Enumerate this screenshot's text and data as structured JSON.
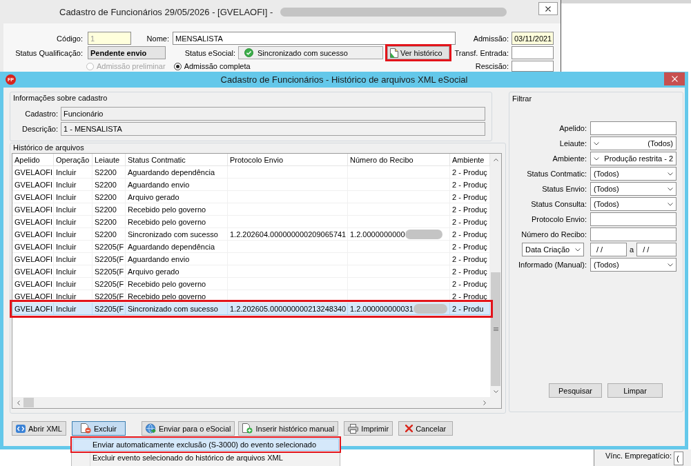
{
  "background_window": {
    "title": "Cadastro de Funcionários 29/05/2026 - [GVELAOFI] -",
    "title_redacted": true,
    "codigo": {
      "label": "Código:",
      "value": "1",
      "disabled": true
    },
    "nome": {
      "label": "Nome:",
      "value": "MENSALISTA"
    },
    "admissao": {
      "label": "Admissão:",
      "value": "03/11/2021"
    },
    "status_qualificacao": {
      "label": "Status Qualificação:",
      "value": "Pendente envio"
    },
    "status_esocial": {
      "label": "Status eSocial:",
      "value": "Sincronizado com sucesso"
    },
    "ver_historico": {
      "label": "Ver histórico",
      "highlighted": true
    },
    "transf_entrada": {
      "label": "Transf. Entrada:"
    },
    "admission_options": [
      {
        "label": "Admissão preliminar",
        "selected": false,
        "disabled": true
      },
      {
        "label": "Admissão completa",
        "selected": true,
        "disabled": false
      }
    ],
    "rescisao": {
      "label": "Rescisão:"
    },
    "vinc_empregaticio": {
      "label": "Vínc. Empregatício:",
      "value": "("
    }
  },
  "dialog": {
    "icon_label": "FP",
    "title": "Cadastro de Funcionários - Histórico de arquivos XML eSocial",
    "info": {
      "title": "Informações sobre cadastro",
      "fields": [
        {
          "label": "Cadastro:",
          "value": "Funcionário"
        },
        {
          "label": "Descrição:",
          "value": "1 - MENSALISTA"
        }
      ]
    },
    "history": {
      "title": "Histórico de arquivos",
      "columns": [
        "Apelido",
        "Operação",
        "Leiaute",
        "Status Contmatic",
        "Protocolo Envio",
        "Número do Recibo",
        "Ambiente"
      ],
      "rows": [
        {
          "apelido": "GVELAOFI",
          "operacao": "Incluir",
          "leiaute": "S2200",
          "status": "Aguardando dependência",
          "ambiente": "2 - Produç",
          "selected": false,
          "highlighted": false
        },
        {
          "apelido": "GVELAOFI",
          "operacao": "Incluir",
          "leiaute": "S2200",
          "status": "Aguardando envio",
          "ambiente": "2 - Produç",
          "selected": false,
          "highlighted": false
        },
        {
          "apelido": "GVELAOFI",
          "operacao": "Incluir",
          "leiaute": "S2200",
          "status": "Arquivo gerado",
          "ambiente": "2 - Produç",
          "selected": false,
          "highlighted": false
        },
        {
          "apelido": "GVELAOFI",
          "operacao": "Incluir",
          "leiaute": "S2200",
          "status": "Recebido pelo governo",
          "ambiente": "2 - Produç",
          "selected": false,
          "highlighted": false
        },
        {
          "apelido": "GVELAOFI",
          "operacao": "Incluir",
          "leiaute": "S2200",
          "status": "Recebido pelo governo",
          "ambiente": "2 - Produç",
          "selected": false,
          "highlighted": false
        },
        {
          "apelido": "GVELAOFI",
          "operacao": "Incluir",
          "leiaute": "S2200",
          "status": "Sincronizado com sucesso",
          "protocolo": "1.2.202604.000000000209065741",
          "recibo": {
            "text": "1.2.0000000000",
            "redacted": true
          },
          "ambiente": "2 - Produç",
          "selected": false,
          "highlighted": false
        },
        {
          "apelido": "GVELAOFI",
          "operacao": "Incluir",
          "leiaute": "S2205(F",
          "status": "Aguardando dependência",
          "ambiente": "2 - Produç",
          "selected": false,
          "highlighted": false
        },
        {
          "apelido": "GVELAOFI",
          "operacao": "Incluir",
          "leiaute": "S2205(F",
          "status": "Aguardando envio",
          "ambiente": "2 - Produç",
          "selected": false,
          "highlighted": false
        },
        {
          "apelido": "GVELAOFI",
          "operacao": "Incluir",
          "leiaute": "S2205(F",
          "status": "Arquivo gerado",
          "ambiente": "2 - Produç",
          "selected": false,
          "highlighted": false
        },
        {
          "apelido": "GVELAOFI",
          "operacao": "Incluir",
          "leiaute": "S2205(F",
          "status": "Recebido pelo governo",
          "ambiente": "2 - Produç",
          "selected": false,
          "highlighted": false
        },
        {
          "apelido": "GVELAOFI",
          "operacao": "Incluir",
          "leiaute": "S2205(F",
          "status": "Recebido pelo governo",
          "ambiente": "2 - Produç",
          "selected": false,
          "highlighted": false
        },
        {
          "apelido": "GVELAOFI",
          "operacao": "Incluir",
          "leiaute": "S2205(F",
          "status": "Sincronizado com sucesso",
          "protocolo": "1.2.202605.000000000213248340",
          "recibo": {
            "text": "1.2.000000000031",
            "redacted": true
          },
          "ambiente": "2 - Produ",
          "selected": true,
          "highlighted": true
        }
      ]
    },
    "filter": {
      "title": "Filtrar",
      "fields": [
        {
          "kind": "text",
          "label": "Apelido:"
        },
        {
          "kind": "combo-left",
          "label": "Leiaute:",
          "value": "(Todos)"
        },
        {
          "kind": "combo-left",
          "label": "Ambiente:",
          "value": "Produção restrita - 2"
        },
        {
          "kind": "combo",
          "label": "Status Contmatic:",
          "value": "(Todos)"
        },
        {
          "kind": "combo",
          "label": "Status Envio:",
          "value": "(Todos)"
        },
        {
          "kind": "combo",
          "label": "Status Consulta:",
          "value": "(Todos)"
        },
        {
          "kind": "text",
          "label": "Protocolo Envio:"
        },
        {
          "kind": "text",
          "label": "Número do Recibo:"
        },
        {
          "kind": "date-range",
          "selector": "Data Criação",
          "from": "/ /",
          "separator": "a",
          "to": "/ /"
        },
        {
          "kind": "combo",
          "label": "Informado (Manual):",
          "value": "(Todos)"
        }
      ],
      "buttons": [
        "Pesquisar",
        "Limpar"
      ]
    },
    "buttons": [
      {
        "label": "Abrir XML",
        "pressed": false
      },
      {
        "label": "Excluir",
        "pressed": true
      },
      {
        "label": "Enviar para o eSocial",
        "pressed": false
      },
      {
        "label": "Inserir histórico manual",
        "pressed": false
      },
      {
        "label": "Imprimir",
        "pressed": false
      },
      {
        "label": "Cancelar",
        "pressed": false
      }
    ]
  },
  "menu": {
    "items": [
      {
        "label": "Enviar automaticamente exclusão (S-3000) do evento selecionado",
        "selected": true,
        "highlighted": true
      },
      {
        "label": "Excluir evento selecionado do histórico de arquivos XML",
        "selected": false,
        "highlighted": false
      }
    ]
  }
}
